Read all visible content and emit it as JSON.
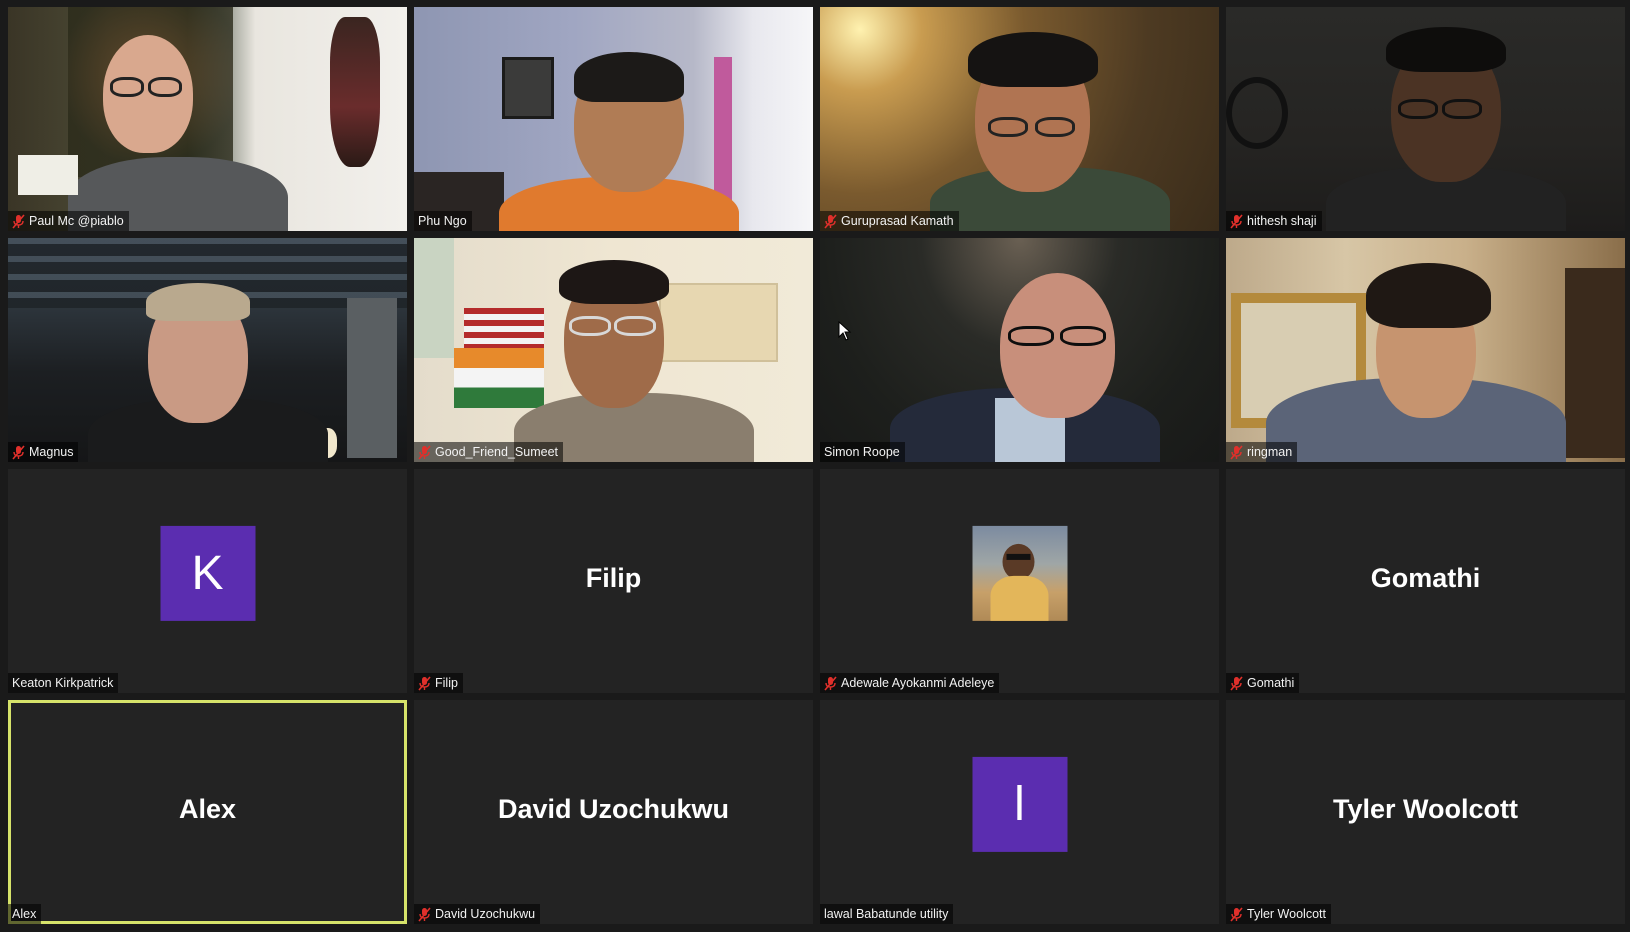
{
  "meeting": {
    "participants": [
      {
        "name": "Paul Mc @piablo",
        "muted": true,
        "type": "video"
      },
      {
        "name": "Phu Ngo",
        "muted": false,
        "type": "video"
      },
      {
        "name": "Guruprasad Kamath",
        "muted": true,
        "type": "video"
      },
      {
        "name": "hithesh shaji",
        "muted": true,
        "type": "video"
      },
      {
        "name": "Magnus",
        "muted": true,
        "type": "video"
      },
      {
        "name": "Good_Friend_Sumeet",
        "muted": true,
        "type": "video"
      },
      {
        "name": "Simon Roope",
        "muted": false,
        "type": "video"
      },
      {
        "name": "ringman",
        "muted": true,
        "type": "video"
      },
      {
        "name": "Keaton Kirkpatrick",
        "muted": false,
        "type": "avatar",
        "initial": "K",
        "avatar_color": "#5b2db0"
      },
      {
        "name": "Filip",
        "muted": true,
        "type": "name",
        "display": "Filip"
      },
      {
        "name": "Adewale Ayokanmi Adeleye",
        "muted": true,
        "type": "photo"
      },
      {
        "name": "Gomathi",
        "muted": true,
        "type": "name",
        "display": "Gomathi"
      },
      {
        "name": "Alex",
        "muted": false,
        "type": "name",
        "display": "Alex",
        "active_speaker": true
      },
      {
        "name": "David Uzochukwu",
        "muted": true,
        "type": "name",
        "display": "David Uzochukwu"
      },
      {
        "name": "lawal Babatunde utility",
        "muted": false,
        "type": "avatar",
        "initial": "l",
        "avatar_color": "#5b2db0"
      },
      {
        "name": "Tyler Woolcott",
        "muted": true,
        "type": "name",
        "display": "Tyler Woolcott"
      }
    ]
  },
  "icons": {
    "mute": "microphone-muted-icon",
    "cursor": "mouse-pointer-icon"
  },
  "colors": {
    "tile_bg": "#232323",
    "active_border": "#d6e36a",
    "muted_red": "#e0302b",
    "avatar_purple": "#5b2db0"
  }
}
